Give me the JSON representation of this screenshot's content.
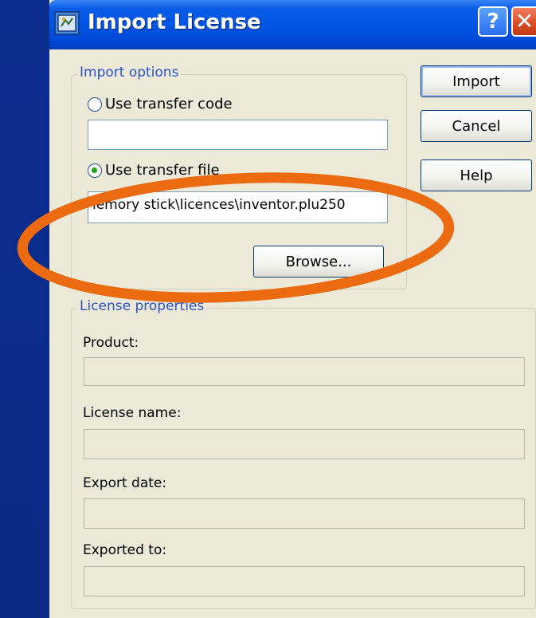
{
  "window": {
    "title": "Import License"
  },
  "titlebar_buttons": {
    "help": "?",
    "close": "✕"
  },
  "import_options": {
    "legend": "Import options",
    "transfer_code": {
      "label": "Use transfer code",
      "selected": false,
      "value": ""
    },
    "transfer_file": {
      "label": "Use transfer file",
      "selected": true,
      "value": "iemory stick\\licences\\inventor.plu250"
    },
    "browse_label": "Browse..."
  },
  "buttons": {
    "import": "Import",
    "cancel": "Cancel",
    "help": "Help"
  },
  "license_properties": {
    "legend": "License properties",
    "product_label": "Product:",
    "product_value": "",
    "license_name_label": "License name:",
    "license_name_value": "",
    "export_date_label": "Export date:",
    "export_date_value": "",
    "exported_to_label": "Exported to:",
    "exported_to_value": ""
  },
  "colors": {
    "highlight": "#ec6a10",
    "titlebar": "#0055e5",
    "dialog_bg": "#ece9d8",
    "legend_text": "#2a53c8"
  },
  "icons": {
    "app": "license-app-icon",
    "help": "help-icon",
    "close": "close-icon"
  }
}
